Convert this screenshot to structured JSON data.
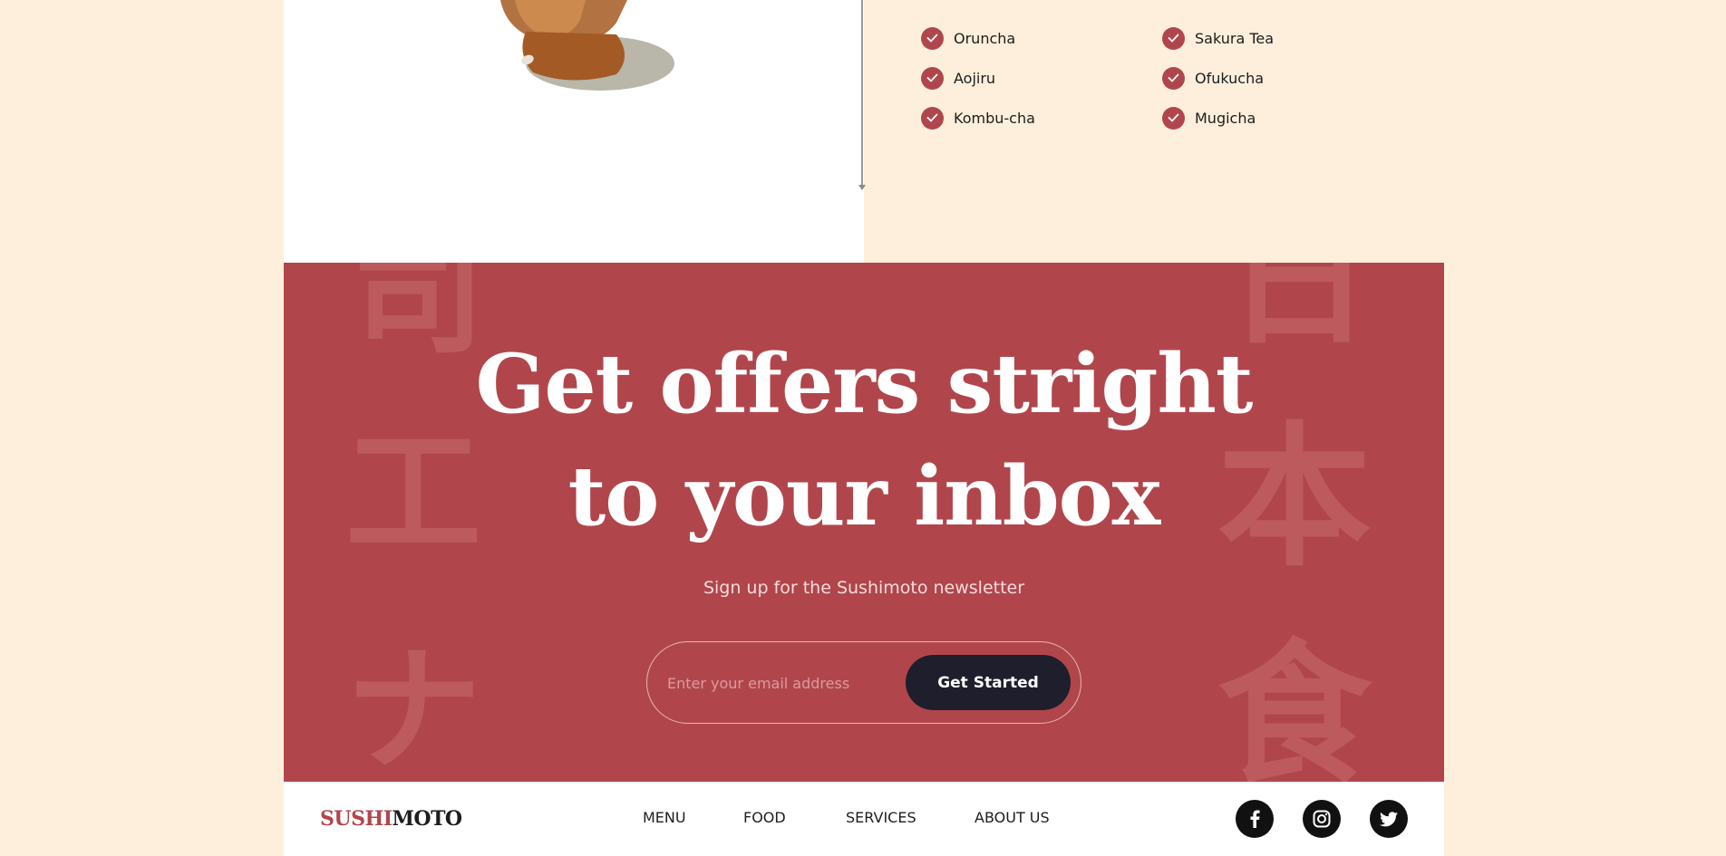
{
  "tea_list": {
    "left_column": [
      "Oruncha",
      "Aojiru",
      "Kombu-cha"
    ],
    "right_column": [
      "Sakura Tea",
      "Ofukucha",
      "Mugicha"
    ]
  },
  "newsletter": {
    "headline_line1": "Get offers stright",
    "headline_line2": "to your inbox",
    "subline": "Sign up for the Sushimoto newsletter",
    "email_placeholder": "Enter your email address",
    "cta_label": "Get Started",
    "background_kanji_left": [
      "司",
      "工",
      "ナ"
    ],
    "background_kanji_right": [
      "日",
      "本",
      "食"
    ]
  },
  "footer": {
    "logo_part1": "SUSHI",
    "logo_part2": "MOTO",
    "nav": [
      "MENU",
      "FOOD",
      "SERVICES",
      "ABOUT US"
    ],
    "social": [
      "facebook-icon",
      "instagram-icon",
      "twitter-icon"
    ]
  },
  "colors": {
    "page_background": "#fdefdc",
    "accent_red": "#b0464b",
    "button_dark": "#1e1e2c"
  }
}
